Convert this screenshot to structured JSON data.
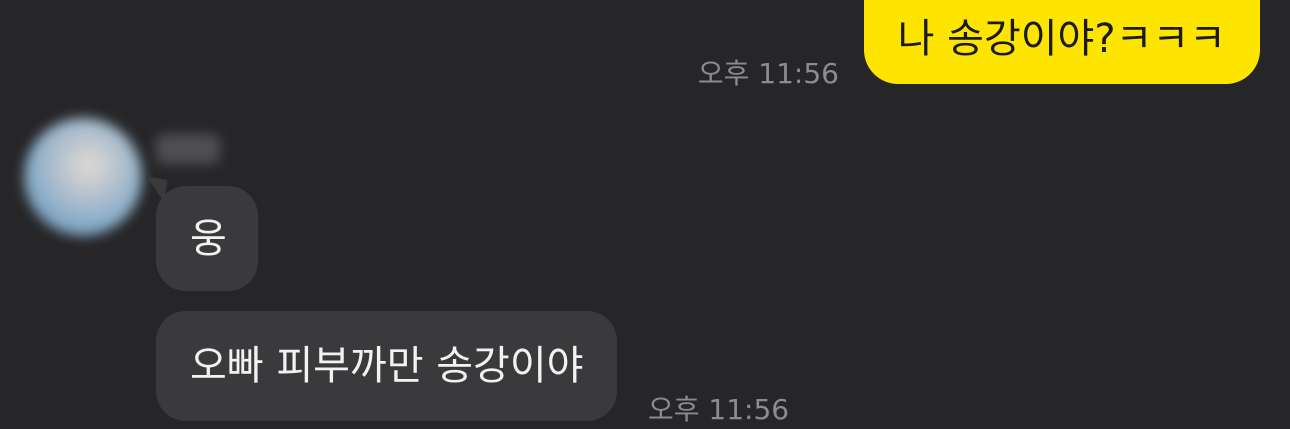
{
  "messages": {
    "outgoing": {
      "text": "나 송강이야?ㅋㅋㅋ",
      "time": "오후 11:56"
    },
    "incoming": {
      "sender_name": "윤서",
      "bubbles": [
        {
          "text": "웅"
        },
        {
          "text": "오빠 피부까만 송강이야"
        }
      ],
      "time": "오후 11:56"
    }
  },
  "colors": {
    "background": "#262628",
    "outgoing_bubble": "#fee500",
    "incoming_bubble": "#3a3a3d",
    "timestamp": "#8c8c90"
  }
}
